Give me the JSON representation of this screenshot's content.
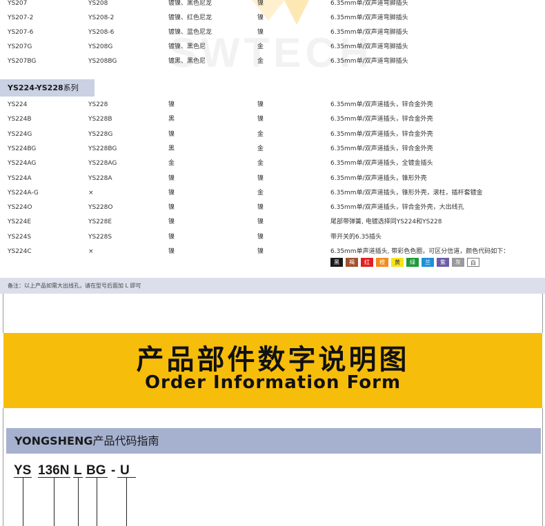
{
  "watermark": "SWTECH",
  "top_rows": [
    [
      "YS207",
      "YS208",
      "镀镍、黑色尼龙",
      "镍",
      "6.35mm单/双声道弯脚插头"
    ],
    [
      "YS207-2",
      "YS208-2",
      "镀镍、红色尼龙",
      "镍",
      "6.35mm单/双声道弯脚插头"
    ],
    [
      "YS207-6",
      "YS208-6",
      "镀镍、蓝色尼龙",
      "镍",
      "6.35mm单/双声道弯脚插头"
    ],
    [
      "YS207G",
      "YS208G",
      "镀镍、黑色尼",
      "金",
      "6.35mm单/双声道弯脚插头"
    ],
    [
      "YS207BG",
      "YS208BG",
      "镀黑、黑色尼",
      "金",
      "6.35mm单/双声道弯脚插头"
    ]
  ],
  "series": {
    "code": "YS224-YS228",
    "suffix": "系列"
  },
  "series_rows": [
    [
      "YS224",
      "YS228",
      "镍",
      "镍",
      "6.35mm单/双声道插头，锌合金外壳"
    ],
    [
      "YS224B",
      "YS228B",
      "黑",
      "镍",
      "6.35mm单/双声道插头，锌合金外壳"
    ],
    [
      "YS224G",
      "YS228G",
      "镍",
      "金",
      "6.35mm单/双声道插头，锌合金外壳"
    ],
    [
      "YS224BG",
      "YS228BG",
      "黑",
      "金",
      "6.35mm单/双声道插头，锌合金外壳"
    ],
    [
      "YS224AG",
      "YS228AG",
      "金",
      "金",
      "6.35mm单/双声道插头，全镀金插头"
    ],
    [
      "YS224A",
      "YS228A",
      "镍",
      "镍",
      "6.35mm单/双声道插头，锥形外壳"
    ],
    [
      "YS224A-G",
      "×",
      "镍",
      "金",
      "6.35mm单/双声道插头，锥形外壳，滚柱，插杆套镀金"
    ],
    [
      "YS224O",
      "YS228O",
      "镍",
      "镍",
      "6.35mm单/双声道插头，锌合金外壳，大出线孔"
    ],
    [
      "YS224E",
      "YS228E",
      "镍",
      "镍",
      "尾部带弹簧, 电镀选择同YS224和YS228"
    ],
    [
      "YS224S",
      "YS228S",
      "镍",
      "镍",
      "带开关的6.35插头"
    ],
    [
      "YS224C",
      "×",
      "镍",
      "镍",
      "6.35mm单声道插头, 带彩色色圈，可区分信道，颜色代码如下："
    ]
  ],
  "swatches": [
    {
      "label": "黑",
      "color": "#1a1a1a",
      "text": "#ffffff"
    },
    {
      "label": "褐",
      "color": "#a0522d",
      "text": "#ffffff"
    },
    {
      "label": "红",
      "color": "#e02020",
      "text": "#ffffff"
    },
    {
      "label": "橙",
      "color": "#f28c1c",
      "text": "#ffffff"
    },
    {
      "label": "黄",
      "color": "#f7e21b",
      "text": "#333333"
    },
    {
      "label": "绿",
      "color": "#1f9a3a",
      "text": "#ffffff"
    },
    {
      "label": "兰",
      "color": "#1e90d8",
      "text": "#ffffff"
    },
    {
      "label": "紫",
      "color": "#6b5ba8",
      "text": "#ffffff"
    },
    {
      "label": "灰",
      "color": "#9a9a9a",
      "text": "#ffffff"
    },
    {
      "label": "白",
      "color": "#ffffff",
      "text": "#333333"
    }
  ],
  "note": "备注：以上产品如需大出线孔，请在型号后面加 L 即可",
  "banner": {
    "title_zh": "产品部件数字说明图",
    "title_en": "Order Information Form"
  },
  "guide": {
    "brand": "YONGSHENG",
    "label": "产品代码指南"
  },
  "code_parts": [
    "YS",
    "136N",
    "L",
    "BG",
    "-",
    "U"
  ],
  "colors": {
    "banner": "#f7bd0b",
    "guide_bar": "#a5b1cf",
    "series_tab": "#c9d1e3",
    "note_bar": "#dcdfeb"
  }
}
